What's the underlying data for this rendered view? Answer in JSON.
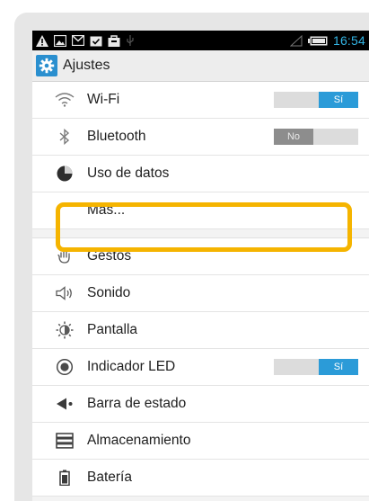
{
  "status_bar": {
    "time": "16:54",
    "accent_color": "#33b5e5",
    "left_icons": [
      "warning-icon",
      "image-icon",
      "gmail-icon",
      "calendar-check-icon",
      "bag-icon",
      "usb-icon"
    ],
    "right_icons": [
      "signal-icon",
      "battery-icon"
    ]
  },
  "action_bar": {
    "title": "Ajustes",
    "icon": "settings-gear-icon"
  },
  "settings": {
    "wifi": {
      "label": "Wi-Fi",
      "toggle": "Sí",
      "on": true
    },
    "bluetooth": {
      "label": "Bluetooth",
      "toggle": "No",
      "on": false
    },
    "data_usage": {
      "label": "Uso de datos"
    },
    "more": {
      "label": "Más..."
    },
    "gestures": {
      "label": "Gestos"
    },
    "sound": {
      "label": "Sonido"
    },
    "display": {
      "label": "Pantalla"
    },
    "led": {
      "label": "Indicador LED",
      "toggle": "Sí",
      "on": true
    },
    "status_bar": {
      "label": "Barra de estado"
    },
    "storage": {
      "label": "Almacenamiento"
    },
    "battery": {
      "label": "Batería"
    }
  },
  "highlight_color": "#f5b400"
}
